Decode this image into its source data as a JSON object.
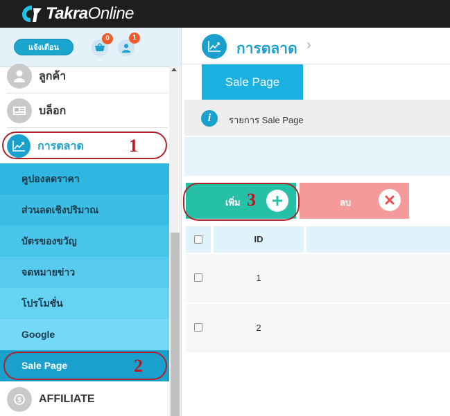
{
  "app": {
    "brand_bold": "Takra",
    "brand_light": "Online"
  },
  "sidebar": {
    "notify_label": "แจ้งเตือน",
    "cart_count": "0",
    "user_count": "1",
    "items": [
      {
        "label": "ลูกค้า",
        "icon": "user-icon"
      },
      {
        "label": "บล็อก",
        "icon": "newspaper-icon"
      },
      {
        "label": "การตลาด",
        "icon": "chart-icon"
      }
    ],
    "submenu": [
      {
        "label": "คูปองลดราคา",
        "bg": "#2fb6e1"
      },
      {
        "label": "ส่วนลดเชิงปริมาณ",
        "bg": "#3cbde5"
      },
      {
        "label": "บัตรของขวัญ",
        "bg": "#49c4ea"
      },
      {
        "label": "จดหมายข่าว",
        "bg": "#57cbef"
      },
      {
        "label": "โปรโมชั่น",
        "bg": "#66d3f3"
      },
      {
        "label": "Google",
        "bg": "#74d9f6"
      },
      {
        "label": "Sale Page",
        "bg": "#1aa0cc"
      }
    ],
    "affiliate_label": "AFFILIATE"
  },
  "main": {
    "page_title": "การตลาด",
    "tab_label": "Sale Page",
    "info_text": "รายการ Sale Page",
    "add_label": "เพิ่ม",
    "delete_label": "ลบ",
    "table": {
      "header_id": "ID",
      "rows": [
        "1",
        "2"
      ]
    }
  },
  "annotations": [
    "1",
    "2",
    "3"
  ],
  "colors": {
    "accent": "#1aa0cc",
    "add": "#26c0a6",
    "delete": "#f49a9b",
    "annotation": "#b0222a"
  }
}
